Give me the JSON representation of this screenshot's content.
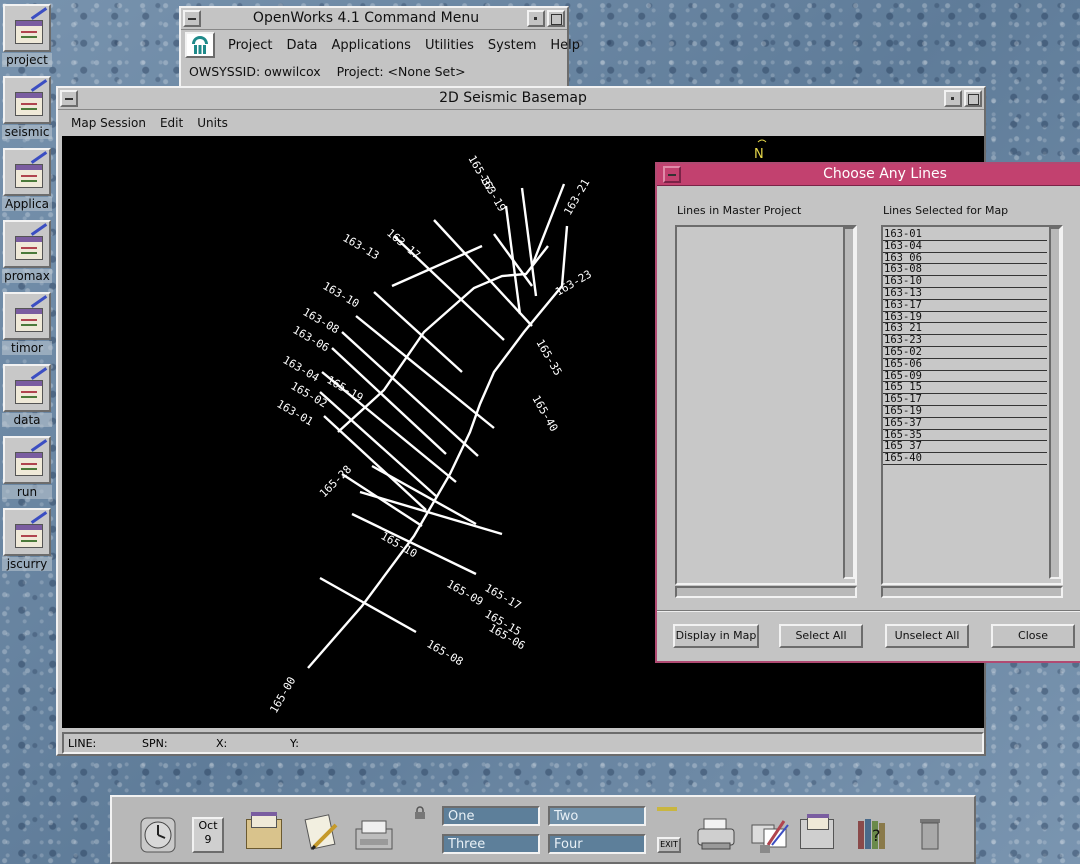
{
  "desktop_icons": [
    {
      "label": "project"
    },
    {
      "label": "seismic"
    },
    {
      "label": "Applica"
    },
    {
      "label": "promax"
    },
    {
      "label": "timor"
    },
    {
      "label": "data"
    },
    {
      "label": "run"
    },
    {
      "label": "jscurry"
    }
  ],
  "command_menu": {
    "title": "OpenWorks 4.1 Command Menu",
    "menus": [
      "Project",
      "Data",
      "Applications",
      "Utilities",
      "System",
      "Help"
    ],
    "status": "OWSYSSID: owwilcox    Project: <None Set>"
  },
  "basemap": {
    "title": "2D Seismic Basemap",
    "menus": [
      "Map Session",
      "Edit",
      "Units"
    ],
    "north_label": "N",
    "readout": {
      "line": "LINE:",
      "sp": "SPN:",
      "x": "X:",
      "y": "Y:"
    },
    "line_labels": [
      "165-00",
      "165-06",
      "165-08",
      "165-09",
      "165-10",
      "165-15",
      "165-17",
      "165-19",
      "165-28",
      "165-35",
      "165-40",
      "163-01",
      "163-04",
      "163-06",
      "163-08",
      "163-10",
      "163-13",
      "163-17",
      "163-19",
      "163-21",
      "163-23",
      "165-02",
      "165-37"
    ]
  },
  "chooser": {
    "title": "Choose Any Lines",
    "left_label": "Lines in Master Project",
    "right_label": "Lines Selected for Map",
    "master_lines": [],
    "selected_lines": [
      "163-01",
      "163-04",
      "163 06",
      "163-08",
      "163-10",
      "163-13",
      "163-17",
      "163-19",
      "163 21",
      "163-23",
      "165-02",
      "165-06",
      "165-09",
      "165 15",
      "165-17",
      "165-19",
      "165-37",
      "165-35",
      "165 37",
      "165-40"
    ],
    "buttons": {
      "display": "Display in Map",
      "select_all": "Select All",
      "unselect_all": "Unselect All",
      "close": "Close"
    }
  },
  "panel": {
    "clock_icon": "clock-icon",
    "date_label": "Oct",
    "date_day": "9",
    "workspaces": [
      "One",
      "Two",
      "Three",
      "Four"
    ],
    "exit_label": "EXIT",
    "active_workspace": "Two"
  }
}
